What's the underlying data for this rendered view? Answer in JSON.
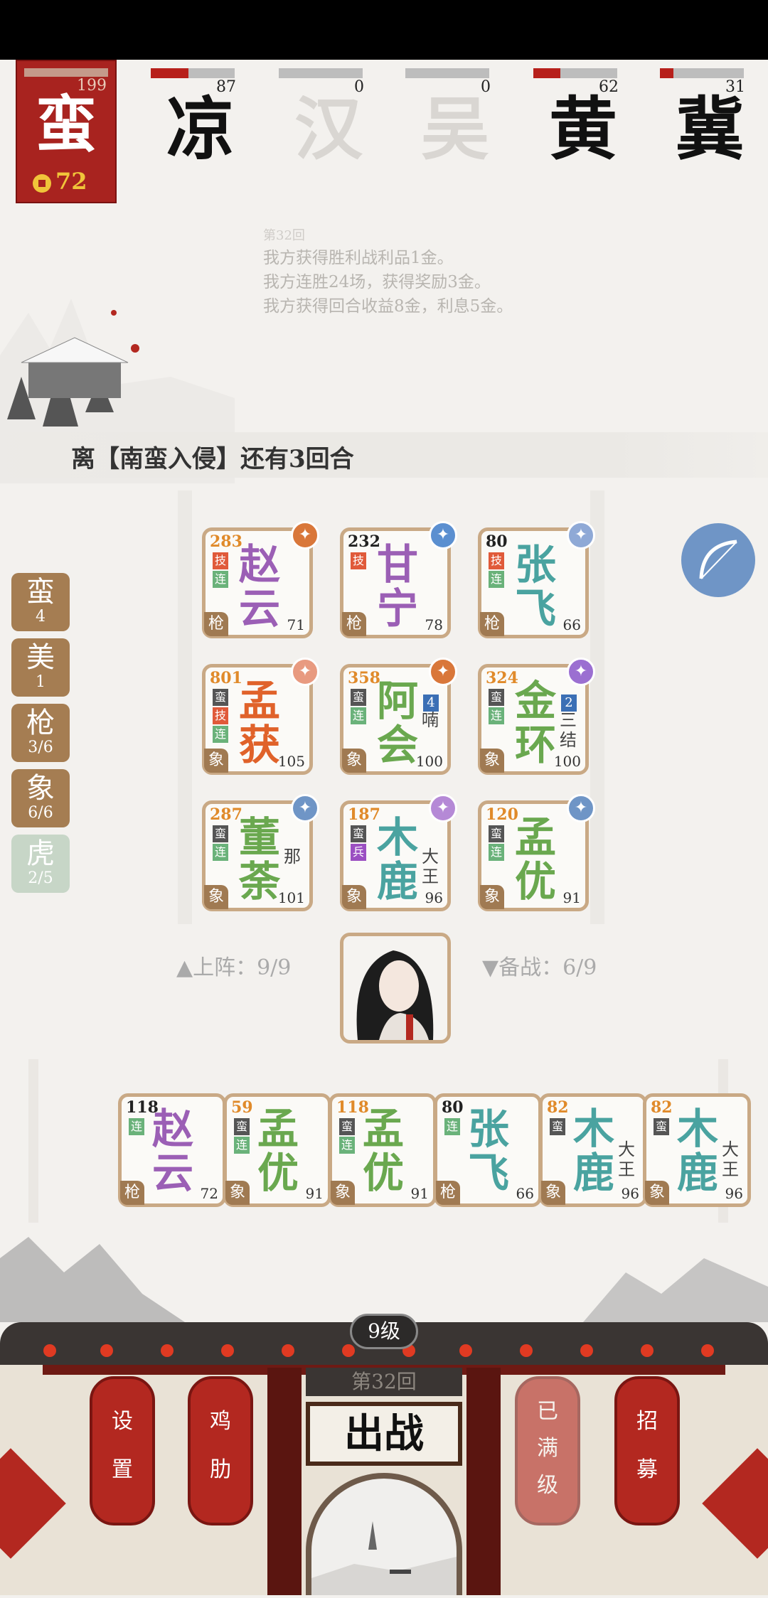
{
  "player": {
    "hp": "199",
    "faction": "蛮",
    "gold": "72"
  },
  "enemies": [
    {
      "name": "凉",
      "hp": "87",
      "fill": 0.45,
      "dead": false
    },
    {
      "name": "汉",
      "hp": "0",
      "fill": 0,
      "dead": true
    },
    {
      "name": "吴",
      "hp": "0",
      "fill": 0,
      "dead": true
    },
    {
      "name": "黄",
      "hp": "62",
      "fill": 0.32,
      "dead": false
    },
    {
      "name": "冀",
      "hp": "31",
      "fill": 0.16,
      "dead": false
    }
  ],
  "log": {
    "round": "第32回",
    "lines": [
      "我方获得胜利战利品1金。",
      "我方连胜24场，获得奖励3金。",
      "我方获得回合收益8金，利息5金。"
    ]
  },
  "banner": "离【南蛮入侵】还有3回合",
  "sidebar": [
    {
      "name": "蛮",
      "count": "4"
    },
    {
      "name": "美",
      "count": "1"
    },
    {
      "name": "枪",
      "count": "3/6"
    },
    {
      "name": "象",
      "count": "6/6"
    },
    {
      "name": "虎",
      "count": "2/5"
    }
  ],
  "board": [
    {
      "hp": "283",
      "name": "赵云",
      "lv": "71",
      "cls": "枪",
      "tags": [
        "技",
        "连"
      ],
      "color": "#9b5fb5",
      "hpColor": "#e08a2a"
    },
    {
      "hp": "232",
      "name": "甘宁",
      "lv": "78",
      "cls": "枪",
      "tags": [
        "技"
      ],
      "color": "#9b5fb5",
      "hpColor": "#222"
    },
    {
      "hp": "80",
      "name": "张飞",
      "lv": "66",
      "cls": "枪",
      "tags": [
        "技",
        "连"
      ],
      "color": "#4aa3a0",
      "hpColor": "#222"
    },
    {
      "hp": "801",
      "name": "孟获",
      "lv": "105",
      "cls": "象",
      "tags": [
        "蛮",
        "技",
        "连"
      ],
      "color": "#e0622a",
      "hpColor": "#e08a2a"
    },
    {
      "hp": "358",
      "name": "阿会",
      "extra": "喃",
      "stack": "4",
      "lv": "100",
      "cls": "象",
      "tags": [
        "蛮",
        "连"
      ],
      "color": "#6aa84f",
      "hpColor": "#e08a2a"
    },
    {
      "hp": "324",
      "name": "金环",
      "extra": "三结",
      "stack": "2",
      "lv": "100",
      "cls": "象",
      "tags": [
        "蛮",
        "连"
      ],
      "color": "#6aa84f",
      "hpColor": "#e08a2a"
    },
    {
      "hp": "287",
      "name": "董荼",
      "extra": "那",
      "lv": "101",
      "cls": "象",
      "tags": [
        "蛮",
        "连"
      ],
      "color": "#6aa84f",
      "hpColor": "#e08a2a"
    },
    {
      "hp": "187",
      "name": "木鹿",
      "extra": "大王",
      "lv": "96",
      "cls": "象",
      "tags": [
        "蛮",
        "兵"
      ],
      "color": "#4aa3a0",
      "hpColor": "#e08a2a"
    },
    {
      "hp": "120",
      "name": "孟优",
      "lv": "91",
      "cls": "象",
      "tags": [
        "蛮",
        "连"
      ],
      "color": "#6aa84f",
      "hpColor": "#e08a2a"
    }
  ],
  "deploy": {
    "onfield": "▲上阵：9/9",
    "reserve": "▼备战：6/9"
  },
  "bench": [
    {
      "hp": "118",
      "name": "赵云",
      "lv": "72",
      "cls": "枪",
      "tags": [
        "连"
      ],
      "color": "#9b5fb5",
      "hpColor": "#222"
    },
    {
      "hp": "59",
      "name": "孟优",
      "lv": "91",
      "cls": "象",
      "tags": [
        "蛮",
        "连"
      ],
      "color": "#6aa84f",
      "hpColor": "#e08a2a"
    },
    {
      "hp": "118",
      "name": "孟优",
      "lv": "91",
      "cls": "象",
      "tags": [
        "蛮",
        "连"
      ],
      "color": "#6aa84f",
      "hpColor": "#e08a2a"
    },
    {
      "hp": "80",
      "name": "张飞",
      "lv": "66",
      "cls": "枪",
      "tags": [
        "连"
      ],
      "color": "#4aa3a0",
      "hpColor": "#222"
    },
    {
      "hp": "82",
      "name": "木鹿",
      "extra": "大王",
      "lv": "96",
      "cls": "象",
      "tags": [
        "蛮"
      ],
      "color": "#4aa3a0",
      "hpColor": "#e08a2a"
    },
    {
      "hp": "82",
      "name": "木鹿",
      "extra": "大王",
      "lv": "96",
      "cls": "象",
      "tags": [
        "蛮"
      ],
      "color": "#4aa3a0",
      "hpColor": "#e08a2a"
    }
  ],
  "bottom": {
    "level": "9级",
    "round": "第32回",
    "fight": "出战",
    "settings": "设置",
    "rib": "鸡肋",
    "maxed": "已满级",
    "recruit": "招募"
  }
}
